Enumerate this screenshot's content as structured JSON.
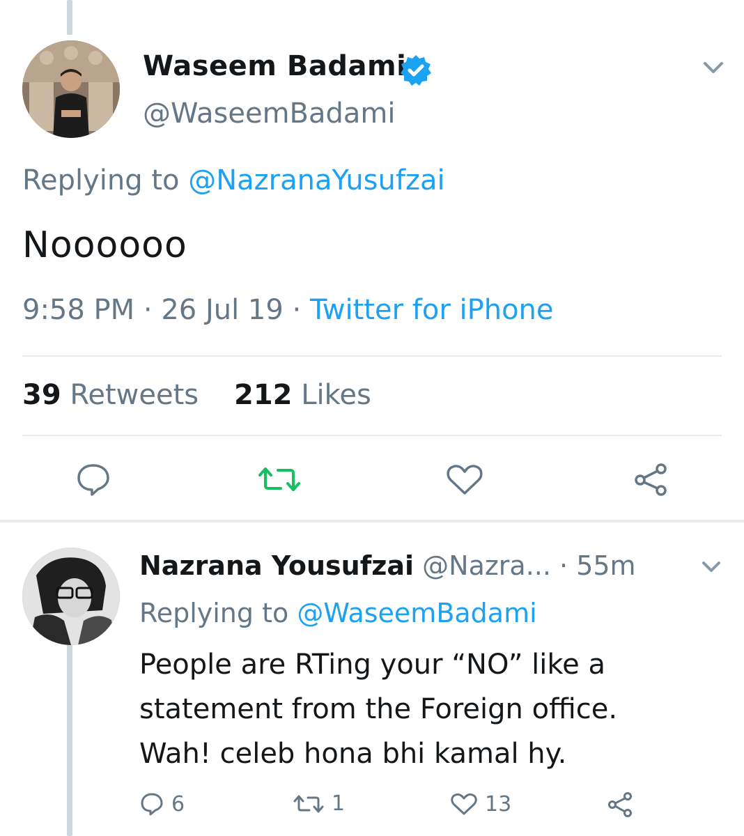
{
  "main_tweet": {
    "display_name": "Waseem Badami",
    "handle": "@WaseemBadami",
    "replying_prefix": "Replying to ",
    "replying_to": "@NazranaYusufzai",
    "text": "Noooooo",
    "time": "9:58 PM",
    "date": "26 Jul 19",
    "separator": " · ",
    "source": "Twitter for iPhone",
    "retweets_count": "39",
    "retweets_label": "Retweets",
    "likes_count": "212",
    "likes_label": "Likes",
    "icons": {
      "verified": "verified-badge-icon",
      "menu": "chevron-down-icon",
      "reply": "reply-icon",
      "retweet": "retweet-icon",
      "like": "heart-icon",
      "share": "share-icon"
    }
  },
  "reply_tweet": {
    "display_name": "Nazrana Yousufzai",
    "handle": "@Nazra...",
    "time": "· 55m",
    "replying_prefix": "Replying to ",
    "replying_to": "@WaseemBadami",
    "text_line1": "People are RTing your “NO” like a",
    "text_line2": "statement from the Foreign office.",
    "text_line3": "Wah! celeb hona bhi kamal hy.",
    "reply_count": "6",
    "retweet_count": "1",
    "like_count": "13"
  },
  "colors": {
    "accent": "#1da1f2",
    "retweet_active": "#17bf63",
    "muted": "#657786",
    "text": "#14171a",
    "divider": "#e6ecf0"
  }
}
